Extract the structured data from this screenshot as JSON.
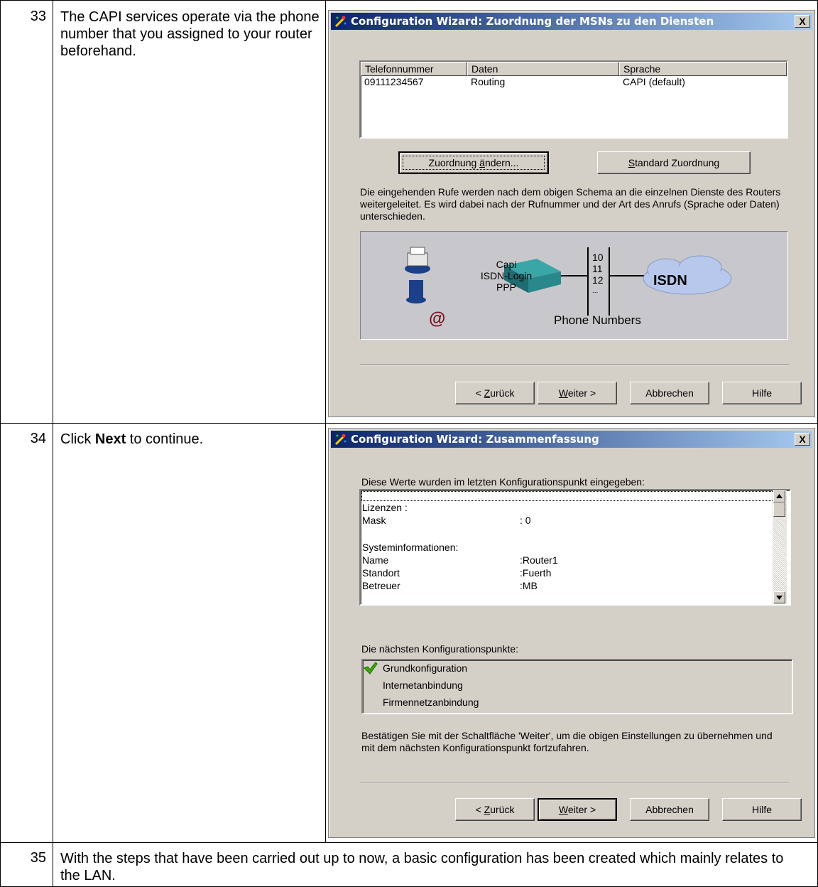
{
  "steps": [
    {
      "number": "33",
      "text": "The CAPI services operate via the phone number that you assigned to your router beforehand."
    },
    {
      "number": "34",
      "text_before": "Click ",
      "text_bold": "Next",
      "text_after": " to continue."
    },
    {
      "number": "35",
      "text": "With the steps that have been carried out up to now, a basic configuration has been created which mainly relates to the LAN."
    }
  ],
  "dialog1": {
    "title": "Configuration Wizard: Zuordnung der MSNs zu den Diensten",
    "close_label": "X",
    "columns": [
      "Telefonnummer",
      "Daten",
      "Sprache"
    ],
    "rows": [
      {
        "telefonnummer": "09111234567",
        "daten": "Routing",
        "sprache": "CAPI (default)"
      }
    ],
    "btn_change_pre": "Zuordnung ",
    "btn_change_u": "ä",
    "btn_change_post": "ndern...",
    "btn_standard_u": "S",
    "btn_standard_post": "tandard Zuordnung",
    "description": "Die eingehenden Rufe werden nach dem obigen Schema an die einzelnen Dienste des Routers weitergeleitet. Es wird dabei nach der Rufnummer und der Art des Anrufs (Sprache oder Daten) unterschieden.",
    "diagram": {
      "services": [
        "Capi",
        "ISDN-Login",
        "PPP"
      ],
      "numbers": [
        "10",
        "11",
        "12",
        "..."
      ],
      "cloud_label": "ISDN",
      "numbers_label": "Phone Numbers",
      "at_symbol": "@"
    },
    "nav": {
      "back_pre": "< ",
      "back_u": "Z",
      "back_post": "urück",
      "next_u": "W",
      "next_post": "eiter >",
      "cancel": "Abbrechen",
      "help": "Hilfe"
    }
  },
  "dialog2": {
    "title": "Configuration Wizard: Zusammenfassung",
    "close_label": "X",
    "intro": "Diese Werte wurden im letzten Konfigurationspunkt eingegeben:",
    "values": [
      {
        "key": "Lizenzen :",
        "val": ""
      },
      {
        "key": "Mask",
        "val": ": 0"
      },
      {
        "key": "",
        "val": ""
      },
      {
        "key": "Systeminformationen:",
        "val": ""
      },
      {
        "key": "Name",
        "val": ":Router1"
      },
      {
        "key": "Standort",
        "val": ":Fuerth"
      },
      {
        "key": "Betreuer",
        "val": ":MB"
      }
    ],
    "next_points_label": "Die nächsten Konfigurationspunkte:",
    "next_points": [
      "Grundkonfiguration",
      "Internetanbindung",
      "Firmennetzanbindung"
    ],
    "confirm_text": "Bestätigen Sie mit der Schaltfläche 'Weiter', um die obigen Einstellungen zu übernehmen und mit dem nächsten Konfigurationspunkt fortzufahren.",
    "nav": {
      "back_pre": "< ",
      "back_u": "Z",
      "back_post": "urück",
      "next_u": "W",
      "next_post": "eiter >",
      "cancel": "Abbrechen",
      "help": "Hilfe"
    }
  },
  "colors": {
    "titlebar_start": "#0a246a",
    "titlebar_end": "#a6caf0",
    "dialog_bg": "#d4d0c8",
    "checkmark": "#3cb000"
  }
}
